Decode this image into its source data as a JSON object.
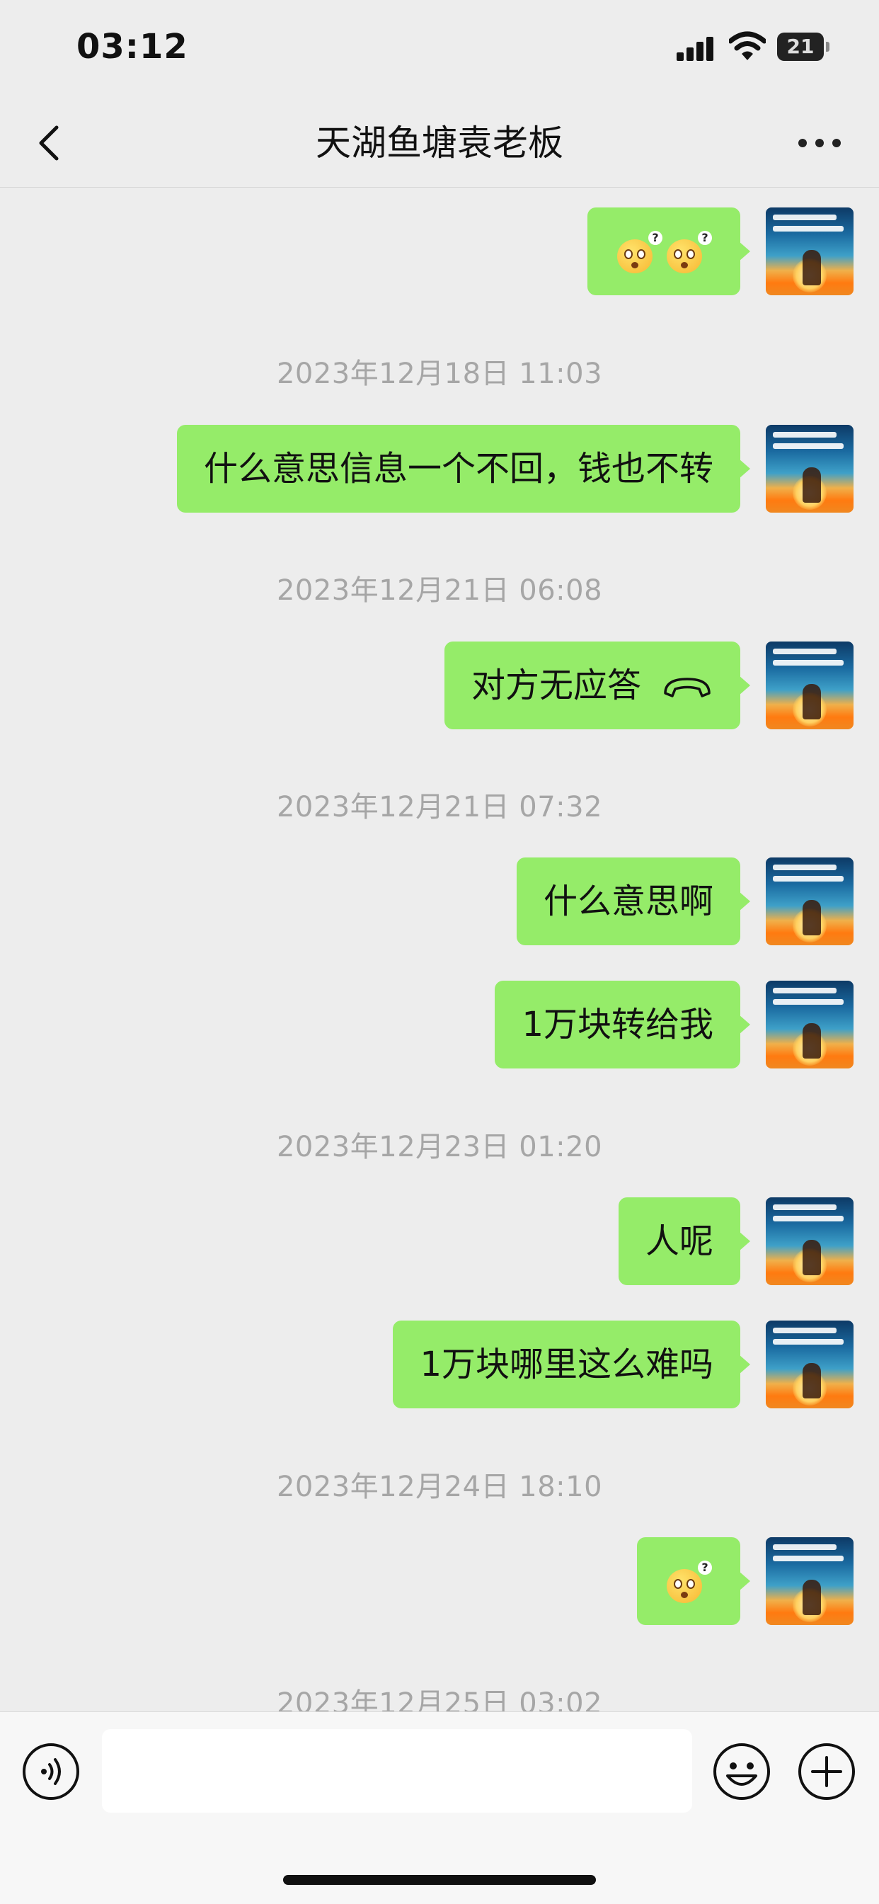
{
  "status_bar": {
    "time": "03:12",
    "battery": "21"
  },
  "nav": {
    "title": "天湖鱼塘袁老板",
    "back_icon": "chevron-left-icon",
    "more_icon": "more-dots-icon"
  },
  "messages": [
    {
      "type": "emoji",
      "sender": "self",
      "emojis": [
        "confused-face-emoji",
        "confused-face-emoji"
      ]
    },
    {
      "type": "timestamp",
      "text": "2023年12月18日 11:03"
    },
    {
      "type": "text",
      "sender": "self",
      "text": "什么意思信息一个不回，钱也不转"
    },
    {
      "type": "timestamp",
      "text": "2023年12月21日 06:08"
    },
    {
      "type": "call",
      "sender": "self",
      "text": "对方无应答",
      "icon": "phone-hangup-icon"
    },
    {
      "type": "timestamp",
      "text": "2023年12月21日 07:32"
    },
    {
      "type": "text",
      "sender": "self",
      "text": "什么意思啊"
    },
    {
      "type": "text",
      "sender": "self",
      "text": "1万块转给我"
    },
    {
      "type": "timestamp",
      "text": "2023年12月23日 01:20"
    },
    {
      "type": "text",
      "sender": "self",
      "text": "人呢"
    },
    {
      "type": "text",
      "sender": "self",
      "text": "1万块哪里这么难吗"
    },
    {
      "type": "timestamp",
      "text": "2023年12月24日 18:10"
    },
    {
      "type": "emoji",
      "sender": "self",
      "emojis": [
        "confused-face-emoji"
      ]
    },
    {
      "type": "timestamp",
      "text": "2023年12月25日 03:02"
    }
  ],
  "input_bar": {
    "placeholder": "",
    "value": "",
    "voice_icon": "voice-icon",
    "emoji_icon": "emoji-icon",
    "plus_icon": "plus-icon"
  },
  "colors": {
    "background": "#ededed",
    "bubble_self": "#95ec69",
    "timestamp": "#a6a6a6",
    "input_bar": "#f7f7f7"
  }
}
